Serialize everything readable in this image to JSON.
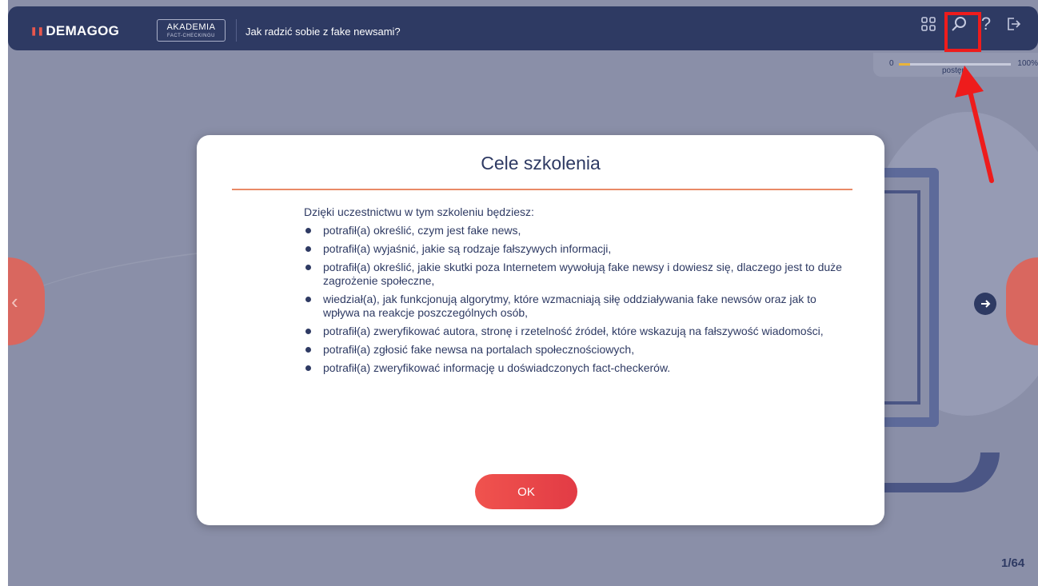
{
  "app": {
    "logo_text": "DEMAGOG",
    "badge_line1": "AKADEMIA",
    "badge_line2": "FACT-CHECKINGU",
    "course_title": "Jak radzić sobie z fake newsami?"
  },
  "toolbar": {
    "icons": [
      "grid-icon",
      "search-icon",
      "help-icon",
      "exit-icon"
    ],
    "help_glyph": "?"
  },
  "progress": {
    "start_label": "0",
    "end_label": "100%",
    "label": "postęp",
    "fraction": 0.02
  },
  "modal": {
    "title": "Cele szkolenia",
    "intro": "Dzięki uczestnictwu w tym szkoleniu będziesz:",
    "goals": [
      "potrafił(a) określić, czym jest fake news,",
      "potrafił(a) wyjaśnić, jakie są rodzaje fałszywych informacji,",
      "potrafił(a) określić, jakie skutki poza Internetem wywołują fake newsy i dowiesz się, dlaczego jest to duże zagrożenie społeczne,",
      "wiedział(a), jak funkcjonują algorytmy, które wzmacniają siłę oddziaływania fake newsów oraz jak to wpływa na reakcje poszczególnych osób,",
      "potrafił(a) zweryfikować autora, stronę i rzetelność źródeł, które wskazują na fałszywość wiadomości,",
      "potrafił(a) zgłosić fake newsa na portalach społecznościowych,",
      "potrafił(a) zweryfikować informację u doświadczonych fact-checkerów."
    ],
    "ok_label": "OK"
  },
  "page_counter": "1/64",
  "colors": {
    "topbar": "#2e3a63",
    "accent": "#e8574d",
    "annotation": "#ee1c1c"
  }
}
